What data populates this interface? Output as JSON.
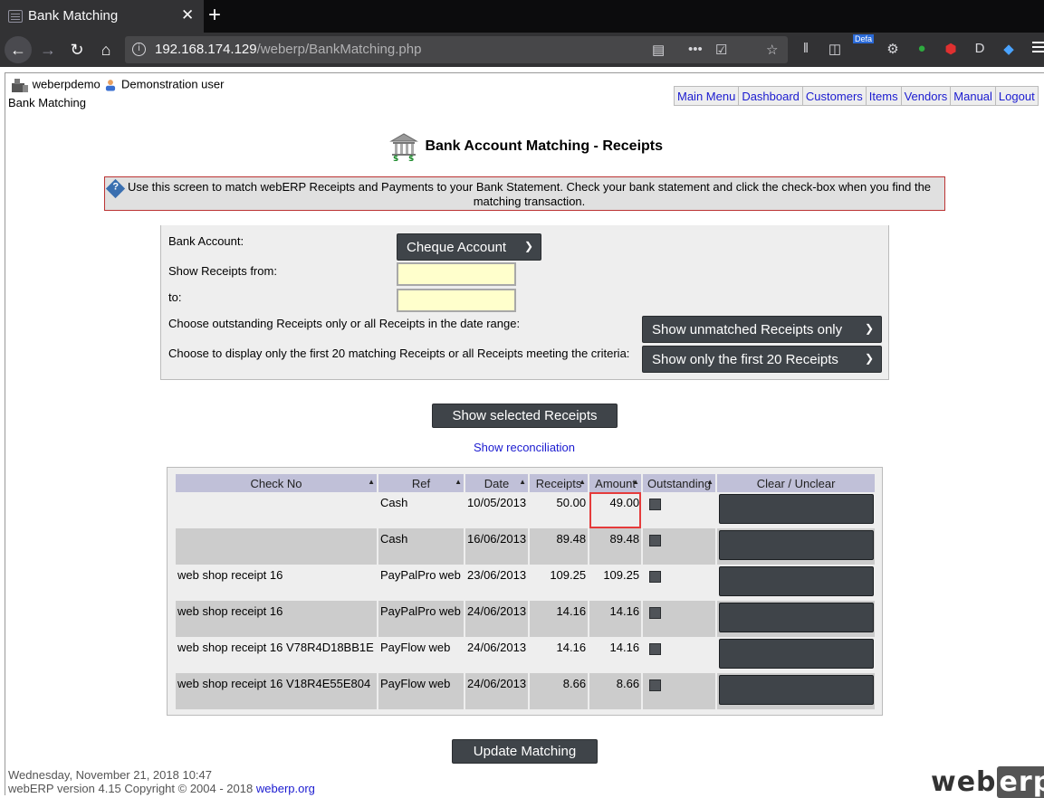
{
  "browser": {
    "tab_title": "Bank Matching",
    "tab_close": "✕",
    "new_tab": "+",
    "url_host": "192.168.174.129",
    "url_path": "/weberp/BankMatching.php",
    "toolbar_badge": "Defa"
  },
  "header": {
    "username": "weberpdemo",
    "user_fullname": "Demonstration user",
    "page_ref": "Bank Matching",
    "menu": [
      "Main Menu",
      "Dashboard",
      "Customers",
      "Items",
      "Vendors",
      "Manual",
      "Logout"
    ]
  },
  "title": "Bank Account Matching - Receipts",
  "notice": "Use this screen to match webERP Receipts and Payments to your Bank Statement. Check your bank statement and click the check-box when you find the matching transaction.",
  "criteria": {
    "bank_account_label": "Bank Account:",
    "bank_account_value": "Cheque Account",
    "from_label": "Show Receipts from:",
    "to_label": "to:",
    "outstanding_label": "Choose outstanding Receipts only or all Receipts in the date range:",
    "outstanding_value": "Show unmatched Receipts only",
    "limit_label": "Choose to display only the first 20 matching Receipts or all Receipts meeting the criteria:",
    "limit_value": "Show only the first 20 Receipts"
  },
  "show_button": "Show selected Receipts",
  "reconciliation_link": "Show reconciliation",
  "table": {
    "headers": [
      "Check No",
      "Ref",
      "Date",
      "Receipts",
      "Amount",
      "Outstanding",
      "Clear / Unclear"
    ],
    "rows": [
      {
        "check_no": "",
        "ref": "Cash",
        "date": "10/05/2013",
        "receipts": "50.00",
        "amount": "49.00"
      },
      {
        "check_no": "",
        "ref": "Cash",
        "date": "16/06/2013",
        "receipts": "89.48",
        "amount": "89.48"
      },
      {
        "check_no": "web shop receipt 16",
        "ref": "PayPalPro web",
        "date": "23/06/2013",
        "receipts": "109.25",
        "amount": "109.25"
      },
      {
        "check_no": "web shop receipt 16",
        "ref": "PayPalPro web",
        "date": "24/06/2013",
        "receipts": "14.16",
        "amount": "14.16"
      },
      {
        "check_no": "web shop receipt 16 V78R4D18BB1E",
        "ref": "PayFlow web",
        "date": "24/06/2013",
        "receipts": "14.16",
        "amount": "14.16"
      },
      {
        "check_no": "web shop receipt 16 V18R4E55E804",
        "ref": "PayFlow web",
        "date": "24/06/2013",
        "receipts": "8.66",
        "amount": "8.66"
      }
    ]
  },
  "update_button": "Update Matching",
  "footer": {
    "datetime": "Wednesday, November 21, 2018 10:47",
    "version": "webERP version 4.15 Copyright © 2004 - 2018",
    "site_link": "weberp.org",
    "logo_web": "web",
    "logo_erp": "erp"
  }
}
